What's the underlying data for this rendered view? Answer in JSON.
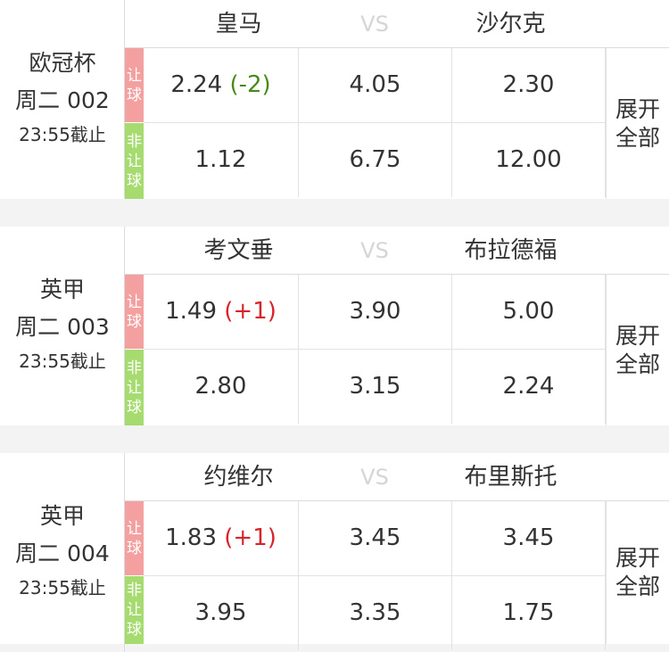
{
  "vs_label": "VS",
  "rq_tag": [
    "让",
    "球"
  ],
  "nrq_tag": [
    "非",
    "让",
    "球"
  ],
  "expand_label": [
    "展开",
    "全部"
  ],
  "colors": {
    "rq_tag": "#f5a0a0",
    "nrq_tag": "#a6db70",
    "handicap_negative": "#4a8a1c",
    "handicap_positive": "#d8232a"
  },
  "matches": [
    {
      "league": "欧冠杯",
      "number": "周二 002",
      "deadline": "23:55截止",
      "home": "皇马",
      "away": "沙尔克",
      "handicap": {
        "home": "2.24",
        "line": "(-2)",
        "draw": "4.05",
        "away": "2.30"
      },
      "no_handicap": {
        "home": "1.12",
        "draw": "6.75",
        "away": "12.00"
      }
    },
    {
      "league": "英甲",
      "number": "周二 003",
      "deadline": "23:55截止",
      "home": "考文垂",
      "away": "布拉德福",
      "handicap": {
        "home": "1.49",
        "line": "(+1)",
        "draw": "3.90",
        "away": "5.00"
      },
      "no_handicap": {
        "home": "2.80",
        "draw": "3.15",
        "away": "2.24"
      }
    },
    {
      "league": "英甲",
      "number": "周二 004",
      "deadline": "23:55截止",
      "home": "约维尔",
      "away": "布里斯托",
      "handicap": {
        "home": "1.83",
        "line": "(+1)",
        "draw": "3.45",
        "away": "3.45"
      },
      "no_handicap": {
        "home": "3.95",
        "draw": "3.35",
        "away": "1.75"
      }
    }
  ]
}
